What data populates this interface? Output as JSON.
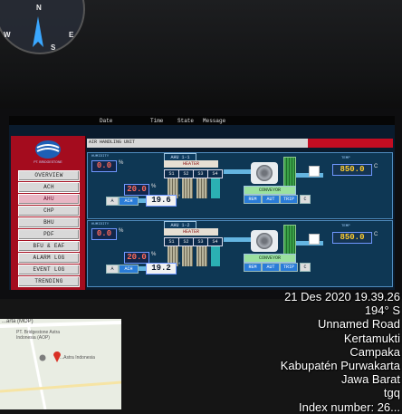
{
  "photo": {
    "compass": {
      "n": "N",
      "e": "E",
      "s": "S",
      "w": "W"
    }
  },
  "hmi": {
    "menu": {
      "date": "Date",
      "time": "Time",
      "state": "State",
      "message": "Message"
    },
    "logo_sub": "PT. BRIDGESTONE",
    "system_title": "AIR HANDLING UNIT",
    "header_right": [
      "",
      ""
    ],
    "nav": [
      {
        "label": "OVERVIEW",
        "active": false
      },
      {
        "label": "ACH",
        "active": false
      },
      {
        "label": "AHU",
        "active": true
      },
      {
        "label": "CHP",
        "active": false
      },
      {
        "label": "BHU",
        "active": false
      },
      {
        "label": "PDF",
        "active": false
      },
      {
        "label": "BFU & EAF",
        "active": false
      },
      {
        "label": "ALARM LOG",
        "active": false
      },
      {
        "label": "EVENT LOG",
        "active": false
      },
      {
        "label": "TRENDING",
        "active": false
      }
    ],
    "units": [
      {
        "tag": "AHU 1-1",
        "humidity_label": "HUMIDITY",
        "humidity_value": "0.0",
        "humidity_unit": "%",
        "heater_label": "HEATER",
        "stages": [
          "S1",
          "S2",
          "S3",
          "S4"
        ],
        "setpoint_value": "20.0",
        "setpoint_unit": "%",
        "temp_value": "19.6",
        "temp_unit": "°",
        "mode_a": "A",
        "mode_b": "ACH",
        "fan_label": "CONVEYOR",
        "fan_btns": [
          "REM",
          "AUT",
          "TRIP"
        ],
        "fan_c": "C",
        "temp_label": "TEMP",
        "out_value": "850.0",
        "out_unit": "C"
      },
      {
        "tag": "AHU 1-2",
        "humidity_label": "HUMIDITY",
        "humidity_value": "0.0",
        "humidity_unit": "%",
        "heater_label": "HEATER",
        "stages": [
          "S1",
          "S2",
          "S3",
          "S4"
        ],
        "setpoint_value": "20.0",
        "setpoint_unit": "%",
        "temp_value": "19.2",
        "temp_unit": "°",
        "mode_a": "A",
        "mode_b": "ACH",
        "fan_label": "CONVEYOR",
        "fan_btns": [
          "REM",
          "AUT",
          "TRIP"
        ],
        "fan_c": "C",
        "temp_label": "TEMP",
        "out_value": "850.0",
        "out_unit": "C"
      }
    ]
  },
  "map": {
    "road": "...arta (MOP)",
    "place1": "PT. Bridgestone Astra Indonesia (AOP)",
    "place2": "...Astra Indonesia"
  },
  "stamp": {
    "datetime": "21 Des 2020 19.39.26",
    "heading": "194° S",
    "road": "Unnamed Road",
    "line3": "Kertamukti",
    "line4": "Campaka",
    "line5": "Kabupatén Purwakarta",
    "line6": "Jawa Barat",
    "line7": "tgq",
    "line8": "Index number: 26..."
  }
}
